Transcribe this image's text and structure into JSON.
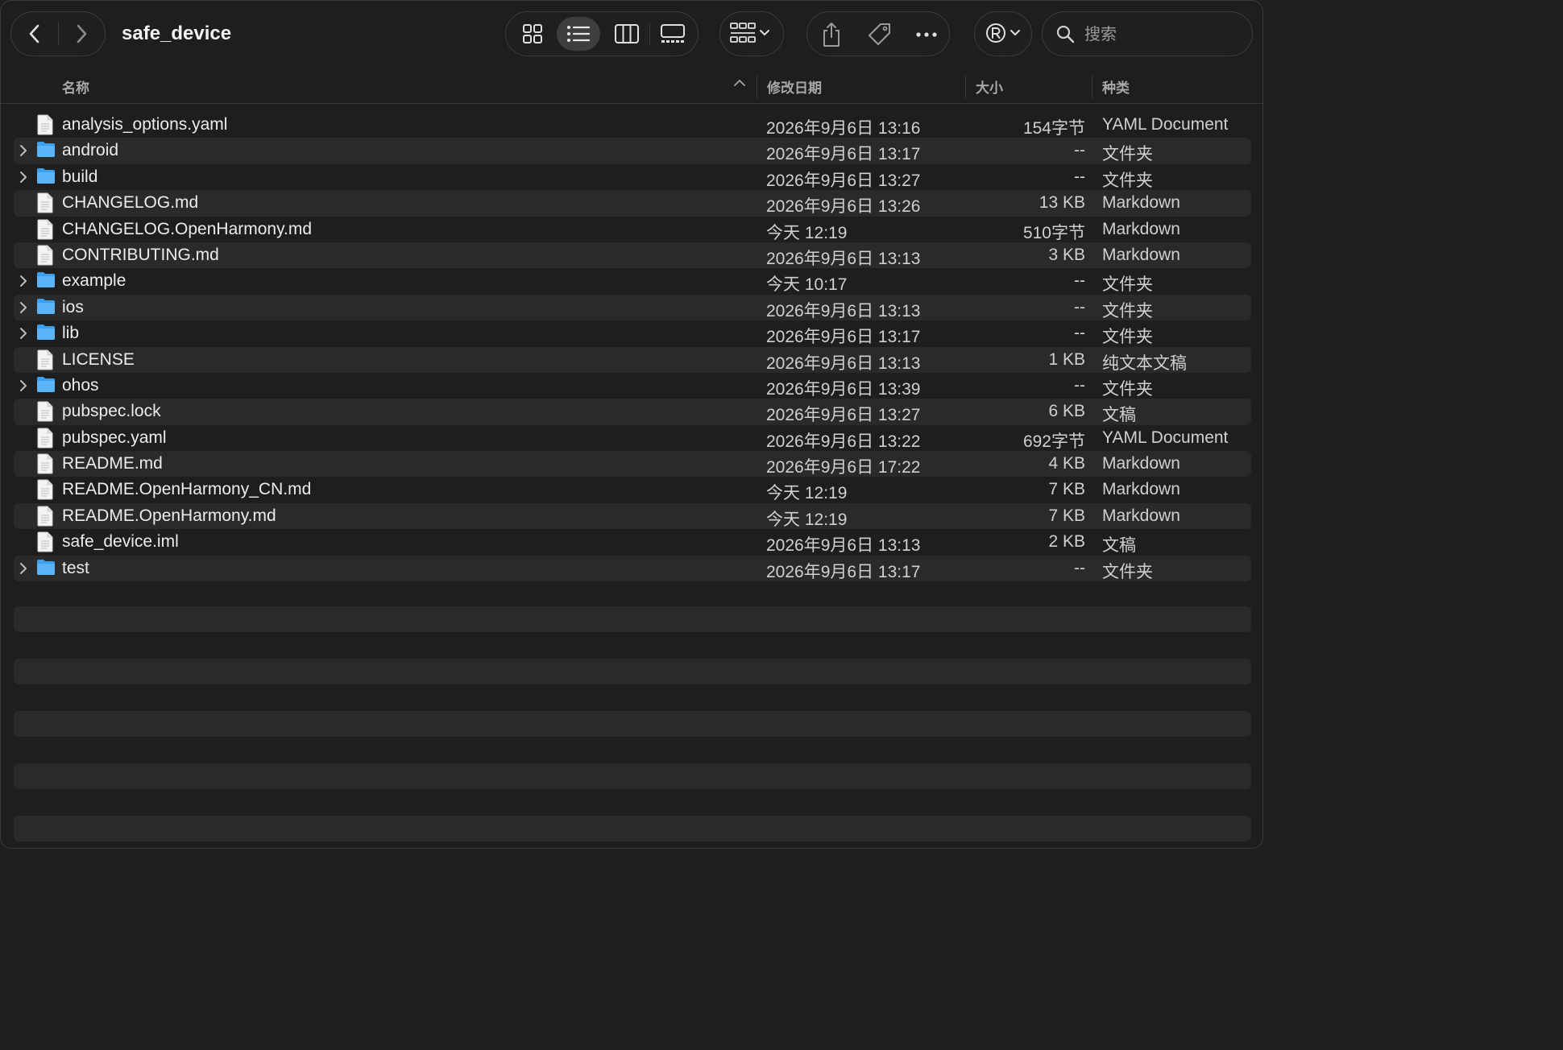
{
  "window": {
    "title": "safe_device"
  },
  "toolbar": {
    "nav": {
      "back_icon": "chevron-left-icon",
      "forward_icon": "chevron-right-icon"
    },
    "views": [
      {
        "name": "icon-view",
        "icon": "grid-icon",
        "active": false
      },
      {
        "name": "list-view",
        "icon": "list-icon",
        "active": true
      },
      {
        "name": "column-view",
        "icon": "columns-icon",
        "active": false
      },
      {
        "name": "gallery-view",
        "icon": "gallery-icon",
        "active": false
      }
    ],
    "group_icon": "group-by-icon",
    "share_icon": "share-icon",
    "tag_icon": "tag-icon",
    "more_icon": "ellipsis-icon",
    "registered_icon": "registered-icon",
    "search": {
      "placeholder": "搜索",
      "value": ""
    }
  },
  "columns": {
    "name": "名称",
    "date": "修改日期",
    "size": "大小",
    "kind": "种类",
    "sort_indicator": "chevron-up-icon"
  },
  "files": [
    {
      "name": "analysis_options.yaml",
      "date": "2026年9月6日 13:16",
      "size": "154字节",
      "kind": "YAML Document",
      "folder": false
    },
    {
      "name": "android",
      "date": "2026年9月6日 13:17",
      "size": "--",
      "kind": "文件夹",
      "folder": true
    },
    {
      "name": "build",
      "date": "2026年9月6日 13:27",
      "size": "--",
      "kind": "文件夹",
      "folder": true
    },
    {
      "name": "CHANGELOG.md",
      "date": "2026年9月6日 13:26",
      "size": "13 KB",
      "kind": "Markdown",
      "folder": false
    },
    {
      "name": "CHANGELOG.OpenHarmony.md",
      "date": "今天 12:19",
      "size": "510字节",
      "kind": "Markdown",
      "folder": false
    },
    {
      "name": "CONTRIBUTING.md",
      "date": "2026年9月6日 13:13",
      "size": "3 KB",
      "kind": "Markdown",
      "folder": false
    },
    {
      "name": "example",
      "date": "今天 10:17",
      "size": "--",
      "kind": "文件夹",
      "folder": true
    },
    {
      "name": "ios",
      "date": "2026年9月6日 13:13",
      "size": "--",
      "kind": "文件夹",
      "folder": true
    },
    {
      "name": "lib",
      "date": "2026年9月6日 13:17",
      "size": "--",
      "kind": "文件夹",
      "folder": true
    },
    {
      "name": "LICENSE",
      "date": "2026年9月6日 13:13",
      "size": "1 KB",
      "kind": "纯文本文稿",
      "folder": false
    },
    {
      "name": "ohos",
      "date": "2026年9月6日 13:39",
      "size": "--",
      "kind": "文件夹",
      "folder": true
    },
    {
      "name": "pubspec.lock",
      "date": "2026年9月6日 13:27",
      "size": "6 KB",
      "kind": "文稿",
      "folder": false
    },
    {
      "name": "pubspec.yaml",
      "date": "2026年9月6日 13:22",
      "size": "692字节",
      "kind": "YAML Document",
      "folder": false
    },
    {
      "name": "README.md",
      "date": "2026年9月6日 17:22",
      "size": "4 KB",
      "kind": "Markdown",
      "folder": false
    },
    {
      "name": "README.OpenHarmony_CN.md",
      "date": "今天 12:19",
      "size": "7 KB",
      "kind": "Markdown",
      "folder": false
    },
    {
      "name": "README.OpenHarmony.md",
      "date": "今天 12:19",
      "size": "7 KB",
      "kind": "Markdown",
      "folder": false
    },
    {
      "name": "safe_device.iml",
      "date": "2026年9月6日 13:13",
      "size": "2 KB",
      "kind": "文稿",
      "folder": false
    },
    {
      "name": "test",
      "date": "2026年9月6日 13:17",
      "size": "--",
      "kind": "文件夹",
      "folder": true
    }
  ],
  "colors": {
    "folder": "#3aa0f0",
    "accent_bg": "#2a2a2a",
    "window_bg": "#1e1e1e"
  }
}
